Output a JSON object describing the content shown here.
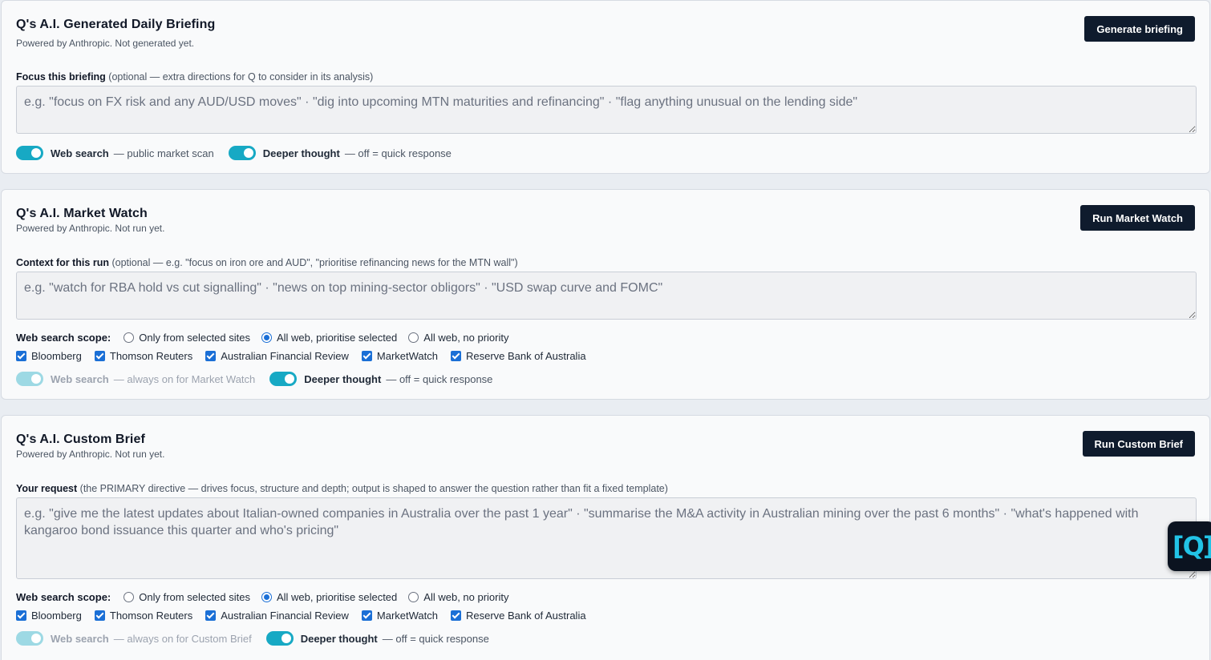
{
  "briefing": {
    "title": "Q's A.I. Generated Daily Briefing",
    "subtitle": "Powered by Anthropic. Not generated yet.",
    "button": "Generate briefing",
    "focus_label": "Focus this briefing",
    "focus_hint": "(optional — extra directions for Q to consider in its analysis)",
    "placeholder": "e.g. \"focus on FX risk and any AUD/USD moves\" · \"dig into upcoming MTN maturities and refinancing\" · \"flag anything unusual on the lending side\"",
    "web_search_label": "Web search",
    "web_search_desc": "— public market scan",
    "deeper_label": "Deeper thought",
    "deeper_desc": "— off = quick response"
  },
  "market": {
    "title": "Q's A.I. Market Watch",
    "subtitle": "Powered by Anthropic. Not run yet.",
    "button": "Run Market Watch",
    "context_label": "Context for this run",
    "context_hint": "(optional — e.g. \"focus on iron ore and AUD\", \"prioritise refinancing news for the MTN wall\")",
    "placeholder": "e.g. \"watch for RBA hold vs cut signalling\" · \"news on top mining-sector obligors\" · \"USD swap curve and FOMC\"",
    "scope_label": "Web search scope:",
    "scope_options": [
      "Only from selected sites",
      "All web, prioritise selected",
      "All web, no priority"
    ],
    "sites": [
      "Bloomberg",
      "Thomson Reuters",
      "Australian Financial Review",
      "MarketWatch",
      "Reserve Bank of Australia"
    ],
    "web_search_label": "Web search",
    "web_search_desc": "— always on for Market Watch",
    "deeper_label": "Deeper thought",
    "deeper_desc": "— off = quick response"
  },
  "custom": {
    "title": "Q's A.I. Custom Brief",
    "subtitle": "Powered by Anthropic. Not run yet.",
    "button": "Run Custom Brief",
    "request_label": "Your request",
    "request_hint": "(the PRIMARY directive — drives focus, structure and depth; output is shaped to answer the question rather than fit a fixed template)",
    "placeholder": "e.g. \"give me the latest updates about Italian-owned companies in Australia over the past 1 year\" · \"summarise the M&A activity in Australian mining over the past 6 months\" · \"what's happened with kangaroo bond issuance this quarter and who's pricing\"",
    "scope_label": "Web search scope:",
    "scope_options": [
      "Only from selected sites",
      "All web, prioritise selected",
      "All web, no priority"
    ],
    "sites": [
      "Bloomberg",
      "Thomson Reuters",
      "Australian Financial Review",
      "MarketWatch",
      "Reserve Bank of Australia"
    ],
    "web_search_label": "Web search",
    "web_search_desc": "— always on for Custom Brief",
    "deeper_label": "Deeper thought",
    "deeper_desc": "— off = quick response"
  },
  "badge": {
    "text": "[Q]"
  },
  "colors": {
    "accent": "#17a9c4",
    "button": "#0f1b2d",
    "checkbox": "#1a6fd6"
  }
}
